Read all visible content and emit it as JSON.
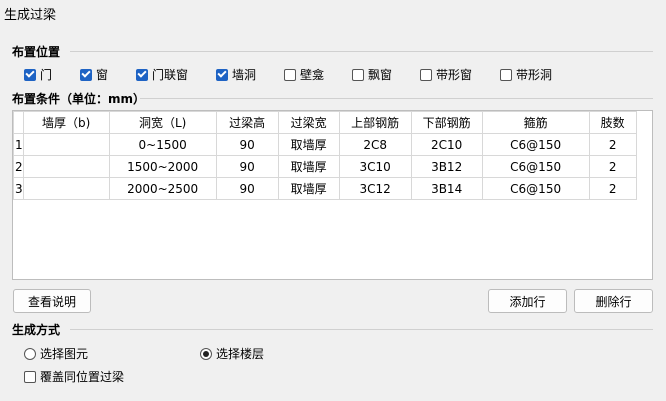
{
  "title": "生成过梁",
  "placement": {
    "label": "布置位置",
    "options": [
      {
        "label": "门",
        "checked": true
      },
      {
        "label": "窗",
        "checked": true
      },
      {
        "label": "门联窗",
        "checked": true
      },
      {
        "label": "墙洞",
        "checked": true
      },
      {
        "label": "壁龛",
        "checked": false
      },
      {
        "label": "飘窗",
        "checked": false
      },
      {
        "label": "带形窗",
        "checked": false
      },
      {
        "label": "带形洞",
        "checked": false
      }
    ]
  },
  "conditions": {
    "label": "布置条件（单位：mm）",
    "columns": [
      "墙厚（b)",
      "洞宽（L)",
      "过梁高",
      "过梁宽",
      "上部钢筋",
      "下部钢筋",
      "箍筋",
      "肢数"
    ],
    "rows": [
      {
        "num": "1",
        "cells": [
          "",
          "0~1500",
          "90",
          "取墙厚",
          "2C8",
          "2C10",
          "C6@150",
          "2"
        ]
      },
      {
        "num": "2",
        "cells": [
          "",
          "1500~2000",
          "90",
          "取墙厚",
          "3C10",
          "3B12",
          "C6@150",
          "2"
        ]
      },
      {
        "num": "3",
        "cells": [
          "",
          "2000~2500",
          "90",
          "取墙厚",
          "3C12",
          "3B14",
          "C6@150",
          "2"
        ]
      }
    ]
  },
  "buttons": {
    "help": "查看说明",
    "add_row": "添加行",
    "delete_row": "删除行"
  },
  "mode": {
    "label": "生成方式",
    "select_element": "选择图元",
    "select_floor": "选择楼层",
    "selected": "select_floor",
    "override": {
      "label": "覆盖同位置过梁",
      "checked": false
    }
  }
}
